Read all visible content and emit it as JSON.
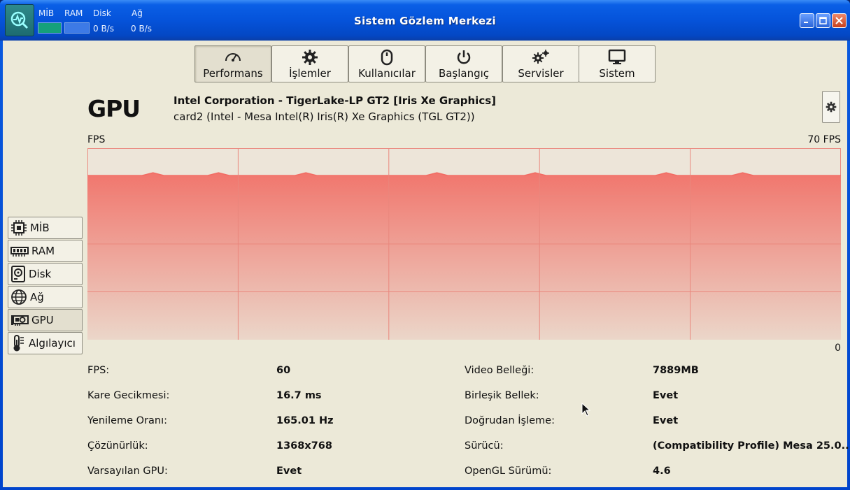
{
  "window": {
    "title": "Sistem Gözlem Merkezi",
    "mini": {
      "cpu_label": "MİB",
      "ram_label": "RAM",
      "disk_label": "Disk",
      "disk_value": "0 B/s",
      "net_label": "Ağ",
      "net_value": "0 B/s"
    }
  },
  "tabs": [
    {
      "label": "Performans",
      "icon": "gauge-icon"
    },
    {
      "label": "İşlemler",
      "icon": "gear-icon"
    },
    {
      "label": "Kullanıcılar",
      "icon": "mouse-icon"
    },
    {
      "label": "Başlangıç",
      "icon": "power-icon"
    },
    {
      "label": "Servisler",
      "icon": "gears-icon"
    },
    {
      "label": "Sistem",
      "icon": "monitor-icon"
    }
  ],
  "side": [
    {
      "label": "MİB",
      "icon": "cpu-icon"
    },
    {
      "label": "RAM",
      "icon": "ram-icon"
    },
    {
      "label": "Disk",
      "icon": "disk-icon"
    },
    {
      "label": "Ağ",
      "icon": "globe-icon"
    },
    {
      "label": "GPU",
      "icon": "gpu-icon"
    },
    {
      "label": "Algılayıcı",
      "icon": "thermometer-icon"
    }
  ],
  "gpu": {
    "heading": "GPU",
    "name": "Intel Corporation - TigerLake-LP GT2 [Iris Xe Graphics]",
    "card": "card2 (Intel - Mesa Intel(R) Iris(R) Xe Graphics (TGL GT2))"
  },
  "chart_data": {
    "type": "area",
    "ylabel": "FPS",
    "ymax_label": "70 FPS",
    "ymin_label": "0",
    "ylim": [
      0,
      70
    ],
    "grid": true,
    "color": "#f26b63",
    "values": [
      60,
      60,
      60,
      60,
      60,
      60,
      61,
      60,
      60,
      60,
      60,
      60,
      61,
      60,
      60,
      60,
      60,
      60,
      60,
      60,
      61,
      60,
      60,
      60,
      60,
      60,
      60,
      60,
      60,
      60,
      60,
      60,
      61,
      60,
      60,
      60,
      60,
      60,
      60,
      60,
      60,
      61,
      60,
      60,
      60,
      60,
      60,
      60,
      60,
      60,
      60,
      60,
      60,
      61,
      60,
      60,
      60,
      60,
      60,
      60,
      61,
      60,
      60,
      60,
      60,
      60,
      60,
      60,
      60,
      60
    ]
  },
  "stats_left": [
    {
      "label": "FPS:",
      "value": "60"
    },
    {
      "label": "Kare Gecikmesi:",
      "value": "16.7 ms"
    },
    {
      "label": "Yenileme Oranı:",
      "value": "165.01 Hz"
    },
    {
      "label": "Çözünürlük:",
      "value": "1368x768"
    },
    {
      "label": "Varsayılan GPU:",
      "value": "Evet"
    }
  ],
  "stats_right": [
    {
      "label": "Video Belleği:",
      "value": "7889MB"
    },
    {
      "label": "Birleşik Bellek:",
      "value": "Evet"
    },
    {
      "label": "Doğrudan İşleme:",
      "value": "Evet"
    },
    {
      "label": "Sürücü:",
      "value": "(Compatibility Profile) Mesa 25.0..."
    },
    {
      "label": "OpenGL Sürümü:",
      "value": "4.6"
    }
  ]
}
